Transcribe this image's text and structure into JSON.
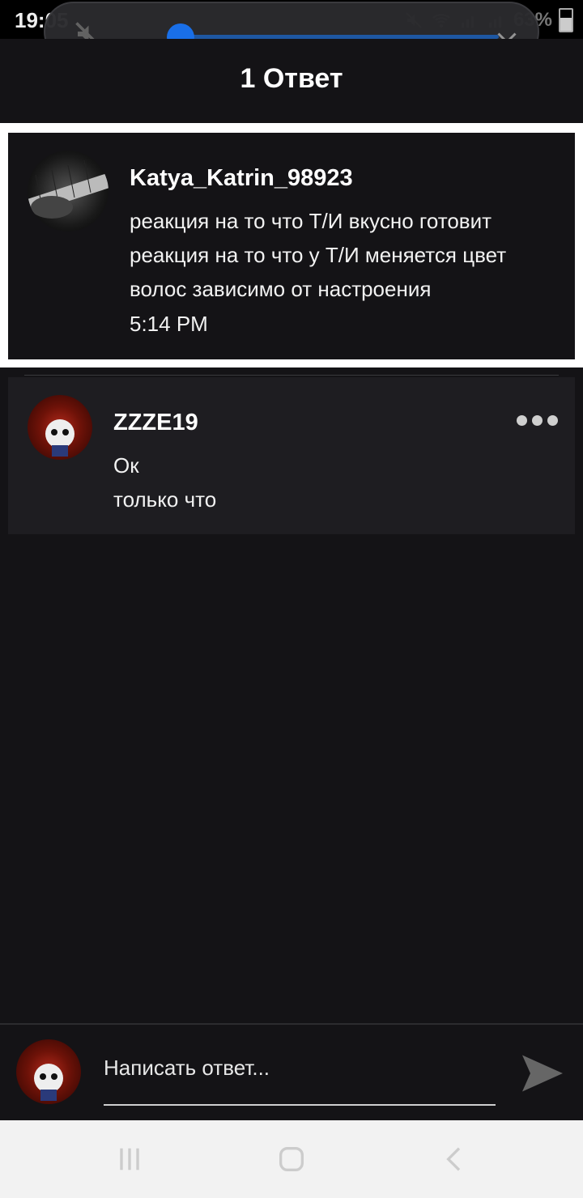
{
  "status_bar": {
    "time": "19:05",
    "battery": "63%",
    "icons": [
      "mute-icon",
      "wifi-icon",
      "signal-icon",
      "signal-icon",
      "battery-icon"
    ]
  },
  "volume_panel": {
    "level": 0.0,
    "icons": [
      "mute-icon",
      "chevron-down-icon"
    ],
    "accent": "#1a73f0"
  },
  "header": {
    "title": "1 Ответ"
  },
  "parent_comment": {
    "username": "Katya_Katrin_98923",
    "lines": [
      "реакция на то что Т/И вкусно готовит",
      "реакция на то что у Т/И меняется цвет",
      "волос зависимо от настроения"
    ],
    "time": "5:14 PM"
  },
  "reply": {
    "username": "ZZZE19",
    "text": "Ок",
    "time": "только что"
  },
  "composer": {
    "placeholder": "Написать ответ...",
    "send_icon": "send-icon"
  },
  "nav": {
    "icons": [
      "recent-apps-icon",
      "home-icon",
      "back-icon"
    ]
  },
  "colors": {
    "background": "#141316",
    "card": "#1e1d21",
    "accent": "#1a73f0"
  }
}
